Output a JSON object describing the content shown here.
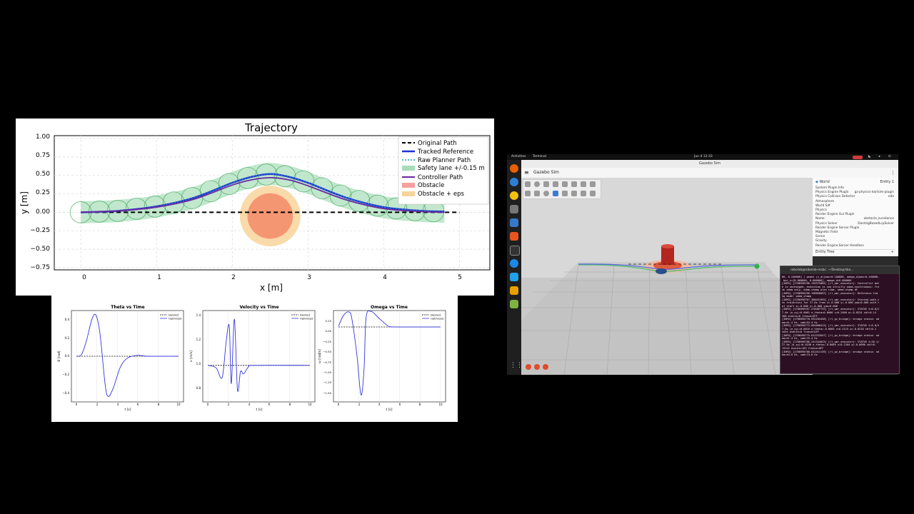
{
  "trajectory": {
    "title": "Trajectory",
    "xlabel": "x [m]",
    "ylabel": "y [m]",
    "legend": [
      "Original Path",
      "Tracked Reference",
      "Raw Planner Path",
      "Safety lane +/-0.15 m",
      "Controller Path",
      "Obstacle",
      "Obstacle + eps"
    ],
    "xticks": [
      "0",
      "1",
      "2",
      "3",
      "4",
      "5"
    ],
    "yticks": [
      "1.00",
      "0.75",
      "0.50",
      "0.25",
      "0.00",
      "−0.25",
      "−0.50",
      "−0.75"
    ]
  },
  "chart_data": [
    {
      "type": "line",
      "title": "Trajectory",
      "xlabel": "x [m]",
      "ylabel": "y [m]",
      "xlim": [
        -0.35,
        5.4
      ],
      "ylim": [
        -0.78,
        1.04
      ],
      "grid": true,
      "legend_position": "top-right",
      "series": [
        {
          "name": "Original Path",
          "x": [
            0,
            5
          ],
          "y": [
            0,
            0
          ]
        },
        {
          "name": "Tracked Reference",
          "x": [
            0,
            0.5,
            1,
            1.5,
            2,
            2.25,
            2.5,
            2.75,
            3,
            3.5,
            4,
            4.5,
            4.8
          ],
          "y": [
            0,
            0.02,
            0.08,
            0.2,
            0.4,
            0.48,
            0.52,
            0.48,
            0.4,
            0.2,
            0.07,
            0.02,
            0.01
          ]
        },
        {
          "name": "Controller Path",
          "x": [
            0,
            0.5,
            1,
            1.5,
            2,
            2.25,
            2.5,
            2.75,
            3,
            3.5,
            4,
            4.5,
            4.8
          ],
          "y": [
            0,
            0.02,
            0.07,
            0.18,
            0.37,
            0.44,
            0.47,
            0.44,
            0.36,
            0.17,
            0.05,
            0.01,
            0.0
          ]
        }
      ],
      "obstacle": {
        "center": [
          2.5,
          -0.05
        ],
        "radius": 0.3,
        "radius_eps": 0.4
      }
    },
    {
      "type": "line",
      "title": "Theta vs Time",
      "xlabel": "t [s]",
      "ylabel": "θ [rad]",
      "xlim": [
        -0.5,
        10.5
      ],
      "ylim": [
        -0.5,
        0.5
      ],
      "series": [
        {
          "name": "Desired",
          "x": [
            0,
            10
          ],
          "y": [
            0,
            0
          ]
        },
        {
          "name": "Optimized",
          "x": [
            0,
            0.5,
            1,
            1.5,
            1.9,
            2.3,
            2.8,
            3.1,
            3.6,
            4.3,
            5,
            6,
            7,
            10
          ],
          "y": [
            0,
            0.02,
            0.18,
            0.4,
            0.45,
            0.25,
            -0.3,
            -0.44,
            -0.35,
            -0.12,
            -0.02,
            0.01,
            0,
            0
          ]
        }
      ]
    },
    {
      "type": "line",
      "title": "Velocity vs Time",
      "xlabel": "t [s]",
      "ylabel": "v [m/s]",
      "xlim": [
        -0.5,
        10.5
      ],
      "ylim": [
        0.7,
        1.45
      ],
      "series": [
        {
          "name": "Desired",
          "x": [
            0,
            10
          ],
          "y": [
            1.0,
            1.0
          ]
        },
        {
          "name": "Optimized",
          "x": [
            0,
            0.8,
            1.4,
            1.8,
            2.1,
            2.3,
            2.6,
            2.9,
            3.2,
            3.5,
            4,
            4.5,
            10
          ],
          "y": [
            1.0,
            0.98,
            0.9,
            1.2,
            1.32,
            0.85,
            1.38,
            0.8,
            0.95,
            0.93,
            0.99,
            1.0,
            1.0
          ]
        }
      ]
    },
    {
      "type": "line",
      "title": "Omega vs Time",
      "xlabel": "t [s]",
      "ylabel": "ω [rad/s]",
      "xlim": [
        -0.5,
        10.5
      ],
      "ylim": [
        -1.6,
        0.35
      ],
      "series": [
        {
          "name": "Desired",
          "x": [
            0,
            10
          ],
          "y": [
            0,
            0
          ]
        },
        {
          "name": "Optimized",
          "x": [
            0,
            0.5,
            1,
            1.3,
            1.8,
            2.2,
            2.5,
            2.7,
            3.2,
            4,
            4.8,
            5.5,
            10
          ],
          "y": [
            0.02,
            0.25,
            0.32,
            0.18,
            -0.6,
            -1.45,
            -0.9,
            0.2,
            0.33,
            0.18,
            0.03,
            0,
            0
          ]
        }
      ]
    }
  ],
  "small_charts": [
    {
      "title": "Theta vs Time",
      "xlabel": "t [s]",
      "ylabel": "θ [rad]",
      "legend": [
        "Desired",
        "Optimized"
      ],
      "xticks": [
        "0",
        "2",
        "4",
        "6",
        "8",
        "10"
      ],
      "yticks": [
        "0.4",
        "0.2",
        "0.0",
        "−0.2",
        "−0.4"
      ]
    },
    {
      "title": "Velocity vs Time",
      "xlabel": "t [s]",
      "ylabel": "v [m/s]",
      "legend": [
        "Desired",
        "Optimized"
      ],
      "xticks": [
        "0",
        "2",
        "4",
        "6",
        "8",
        "10"
      ],
      "yticks": [
        "1.4",
        "1.2",
        "1.0",
        "0.8"
      ]
    },
    {
      "title": "Omega vs Time",
      "xlabel": "t [s]",
      "ylabel": "ω [rad/s]",
      "legend": [
        "Desired",
        "Optimized"
      ],
      "xticks": [
        "0",
        "2",
        "4",
        "6",
        "8",
        "10"
      ],
      "yticks": [
        "0.25",
        "0.00",
        "−0.25",
        "−0.50",
        "−0.75",
        "−1.00",
        "−1.25",
        "−1.50"
      ]
    }
  ],
  "desktop": {
    "activities": "Activities",
    "terminal_app": "Terminal",
    "clock": "Jun 4  12:33",
    "window_title": "Gazebo Sim",
    "header_title": "Gazebo Sim",
    "panel": {
      "root": "World",
      "entity_label": "Entity 1",
      "rows": [
        {
          "label": "System Plugin Info",
          "value": ""
        },
        {
          "label": "Physics Engine Plugin",
          "value": "gz-physics-dartsim-plugin"
        },
        {
          "label": "Physics Collision Detector",
          "value": "ode"
        },
        {
          "label": "Atmosphere",
          "value": ""
        },
        {
          "label": "World Sdf",
          "value": ""
        },
        {
          "label": "Physics",
          "value": ""
        },
        {
          "label": "Render Engine Gui Plugin",
          "value": ""
        },
        {
          "label": "Name",
          "value": "obstacle_avoidance"
        },
        {
          "label": "Physics Solver",
          "value": "DantzigBoxedLcpSolver"
        },
        {
          "label": "Render Engine Server Plugin",
          "value": ""
        },
        {
          "label": "Magnetic Field",
          "value": ""
        },
        {
          "label": "Scene",
          "value": ""
        },
        {
          "label": "Gravity",
          "value": ""
        },
        {
          "label": "Render Engine Server Headless",
          "value": ""
        }
      ],
      "entity_tree": "Entity Tree"
    },
    "terminal": {
      "title": "robolab@robolab-msbc: ~/Desktop/sbo...",
      "lines": [
        "00, 0.240000] | peaks |v_dj|max=0.100000, omega_d|max=0.150000,",
        " bar_v=[0.060000, 0.000000], omega_d=0.000000",
        "[INFO] [1780590766.139375882] [rl_wmr_executor]: Controller mat",
        "h is unchanged, execution is now strictly odom-synchronous: fre",
        "sh odom only, odom-stamp plan time, odom-stamp dt",
        "[INFO] [1780590766.198056097] [rl_wmr_executor]: Reference tim",
        "ng mode: odom_stamp",
        "[INFO] [1780590767.388451955] [rl_wmr_executor]: Started path_c",
        "sv trajectory for 27.0s from x=-0.000 y=-0.000 yaw=0.000 with r",
        "ef start x=-0.000 y=-0.000 yaw=0.000",
        "[INFO] [1780590767.278487732] [rl_wmr_executor]: STATUS t=0.0/2",
        "7.0s |e_xy|=0.0061 e_theta=0.0000 v=0.2400 w=-0.0234 cbf=0.14",
        "308 events=0 freeze=OFF",
        "[INFO] [1780590770.932264458] [rl_gz_bridge]: bridge status: od",
        "om=41.4 Hz, cmd=54.4 Hz",
        "[INFO] [1780590773.004088413] [rl_wmr_executor]: STATUS t=5.0/2",
        "7.0s |e_xy|=0.0016 e_theta=-0.0065 v=0.2115 w=-0.0210 cbf=0.1",
        "4454 events=0 freeze=OFF",
        "[INFO] [1780590775.012332647] [rl_gz_bridge]: bridge status: od",
        "om=41.4 Hz, cmd=75.4 Hz",
        "[INFO] [1780590780.241344023] [rl_wmr_executor]: STATUS t=10.1/",
        "27.0s |e_xy|=0.0238 e_theta=-0.0069 v=0.1204 w=-0.0096 cbf=0.",
        "13122 events=163 freeze=OFF",
        "[INFO] [1780590780.012411139] [rl_gz_bridge]: bridge status: od",
        "om=44.0 Hz, cmd=74.6 Hz"
      ]
    }
  }
}
